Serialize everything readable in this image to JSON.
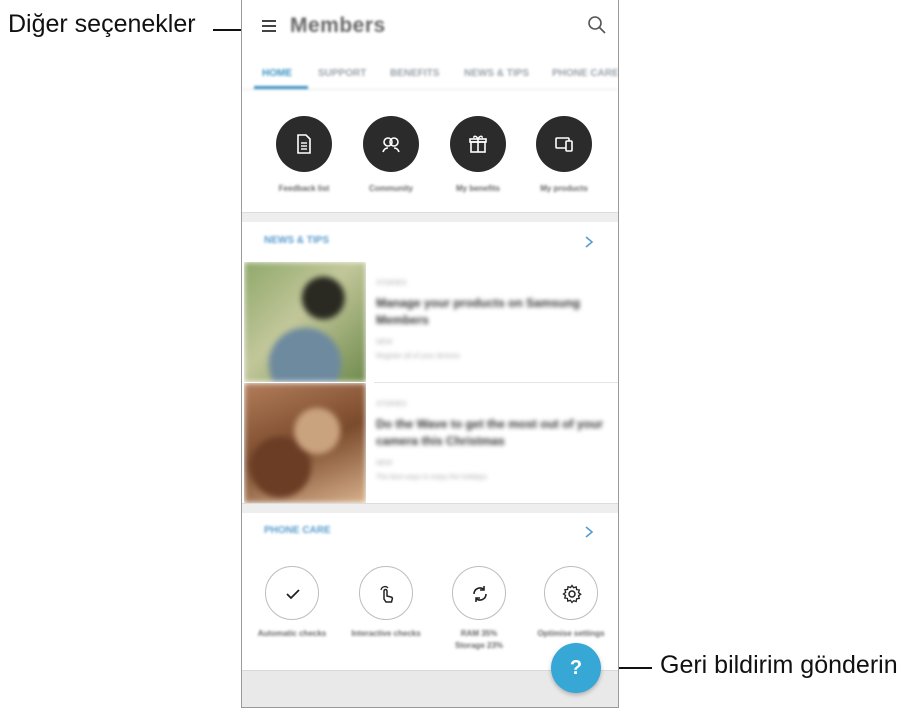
{
  "callouts": {
    "more_options": "Diğer seçenekler",
    "send_feedback": "Geri bildirim gönderin"
  },
  "app": {
    "title": "Members"
  },
  "tabs": [
    {
      "label": "HOME",
      "active": true
    },
    {
      "label": "SUPPORT",
      "active": false
    },
    {
      "label": "BENEFITS",
      "active": false
    },
    {
      "label": "NEWS & TIPS",
      "active": false
    },
    {
      "label": "PHONE CARE",
      "active": false
    }
  ],
  "quick_actions": [
    {
      "label": "Feedback list",
      "icon": "document-icon"
    },
    {
      "label": "Community",
      "icon": "community-icon"
    },
    {
      "label": "My benefits",
      "icon": "gift-icon"
    },
    {
      "label": "My products",
      "icon": "devices-icon"
    }
  ],
  "news": {
    "title": "NEWS & TIPS",
    "items": [
      {
        "kicker": "STORIES",
        "title": "Manage your products on Samsung Members",
        "meta1": "NEW",
        "meta2": "Register all of your devices"
      },
      {
        "kicker": "STORIES",
        "title": "Do the Wave to get the most out of your camera this Christmas",
        "meta1": "NEW",
        "meta2": "The best ways to enjoy the holidays"
      }
    ]
  },
  "phone_care": {
    "title": "PHONE CARE",
    "items": [
      {
        "label": "Automatic checks",
        "label2": "",
        "icon": "check-icon"
      },
      {
        "label": "Interactive checks",
        "label2": "",
        "icon": "touch-icon"
      },
      {
        "label": "RAM 35%",
        "label2": "Storage 23%",
        "icon": "refresh-icon"
      },
      {
        "label": "Optimise settings",
        "label2": "",
        "icon": "settings-icon"
      }
    ]
  },
  "fab": {
    "label": "?"
  },
  "colors": {
    "accent": "#3b93c4",
    "fab": "#37a7d6",
    "dark_icon_bg": "#2b2b2b"
  }
}
